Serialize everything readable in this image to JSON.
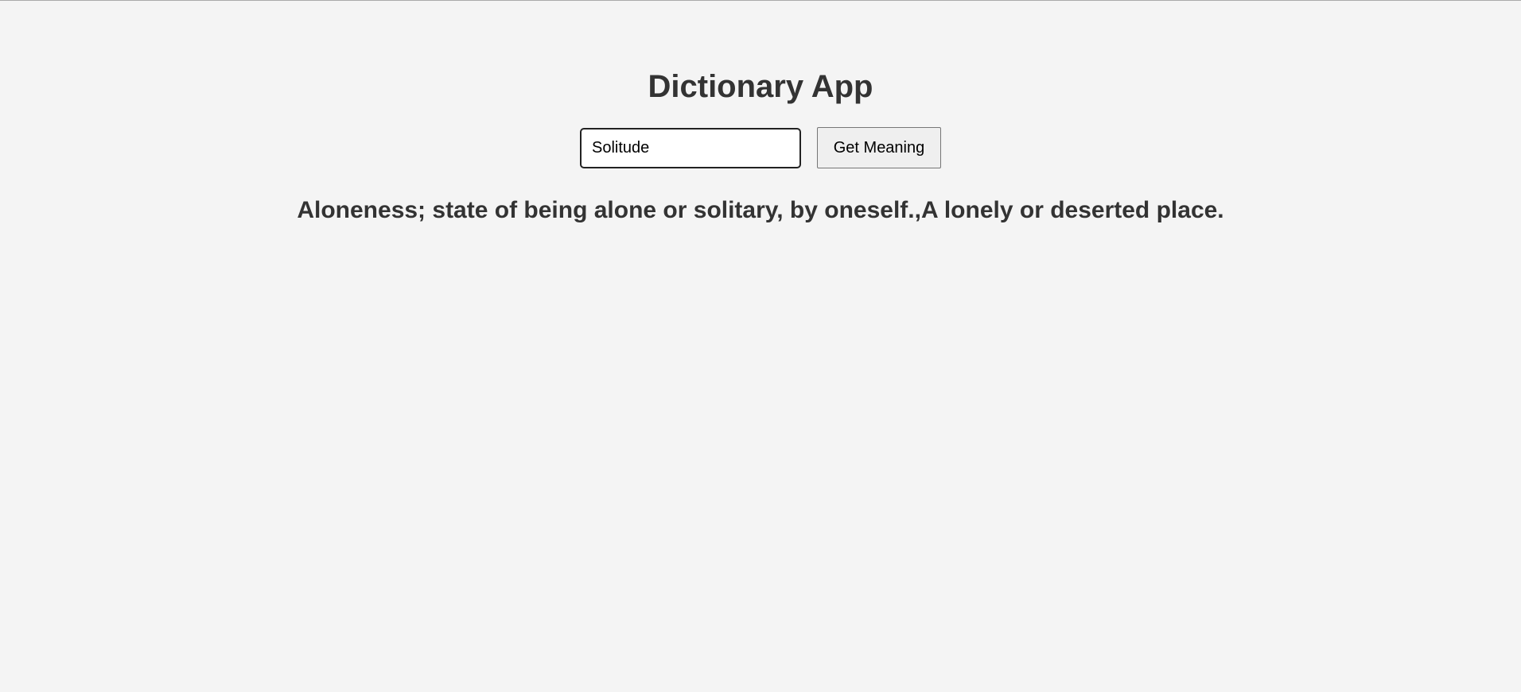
{
  "app": {
    "title": "Dictionary App"
  },
  "search": {
    "value": "Solitude",
    "placeholder": ""
  },
  "toolbar": {
    "get_meaning_label": "Get Meaning"
  },
  "result": {
    "meaning": "Aloneness; state of being alone or solitary, by oneself.,A lonely or deserted place."
  },
  "colors": {
    "background": "#f4f4f4",
    "text": "#333333",
    "button_bg": "#efefef"
  }
}
